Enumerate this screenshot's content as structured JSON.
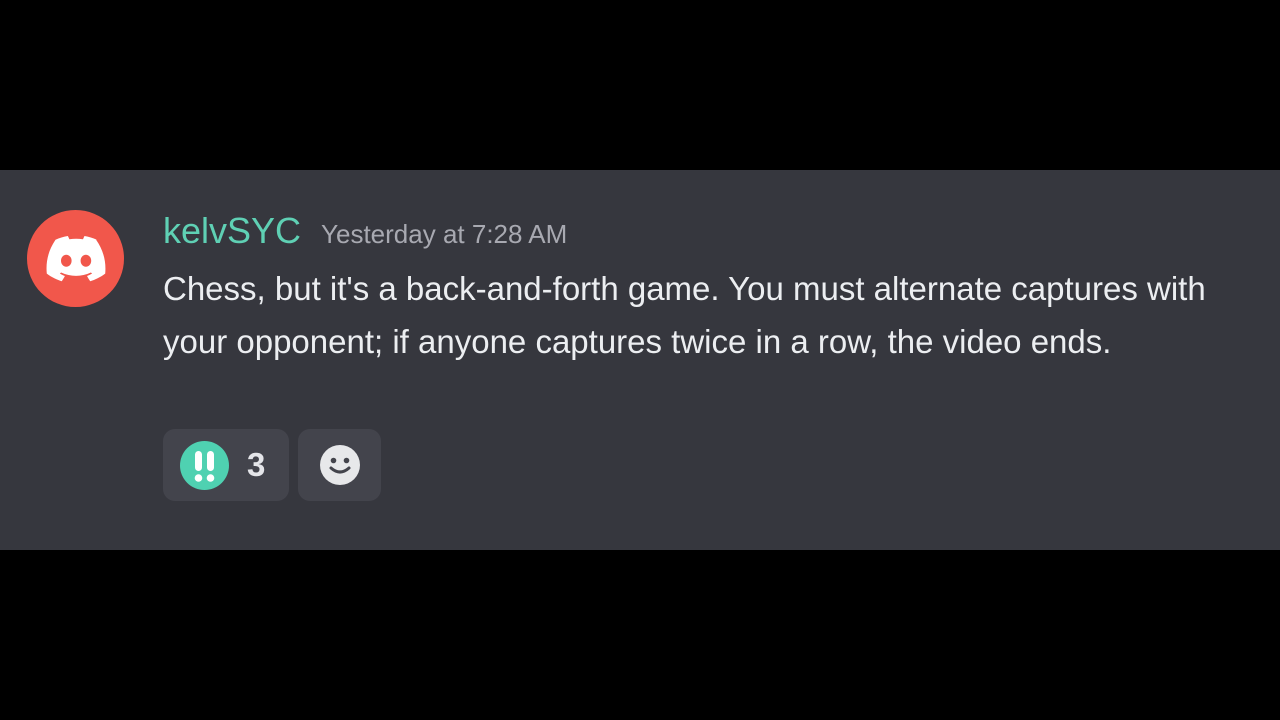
{
  "message": {
    "avatar_icon": "discord-logo-icon",
    "avatar_color": "#f1574b",
    "username": "kelvSYC",
    "username_color": "#5fd0b4",
    "timestamp": "Yesterday at 7:28 AM",
    "body": "Chess, but it's a back-and-forth game. You must alternate captures with your opponent; if anyone captures twice in a row, the video ends."
  },
  "reactions": [
    {
      "emoji_icon": "double-exclamation-icon",
      "emoji_color": "#4fd1b1",
      "count": "3"
    }
  ],
  "add_reaction": {
    "icon": "smiley-face-icon"
  }
}
